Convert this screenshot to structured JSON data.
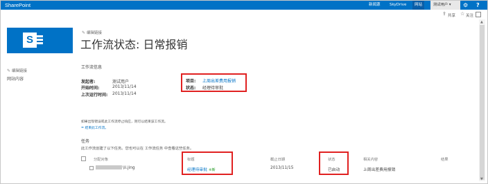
{
  "suite": {
    "brand": "SharePoint",
    "links": [
      "新闻源",
      "SkyDrive",
      "网站"
    ],
    "user": "测试用户 ▾",
    "settings_icon": "gear-icon",
    "help_icon": "question-icon"
  },
  "actions": {
    "share": "共享",
    "follow": "关注"
  },
  "edit_links": {
    "top": "编辑链接",
    "left": "编辑链接"
  },
  "page": {
    "title": "工作流状态: 日常报销"
  },
  "left_nav": {
    "site_contents": "网站内容"
  },
  "workflow_info": {
    "header": "工作流信息",
    "initiator_label": "发起者:",
    "initiator": "测试用户",
    "started_label": "开始时间:",
    "started": "2013/11/14",
    "last_run_label": "上次运行时间:",
    "last_run": "2013/11/14",
    "item_label": "项目:",
    "item": "上周出差费用报销",
    "status_label": "状态:",
    "status": "经理待审批"
  },
  "notes": {
    "line1": "如果出现错误或此工作流停止响应，则可以结束该工作流。",
    "line2": "= 结束此工作流。"
  },
  "tasks": {
    "header": "任务",
    "intro": "此工作流创建了以下任务。您也可以在 工作流任务 中查看这些任务。",
    "columns": [
      "分配对象",
      "标题",
      "截止日期",
      "状态",
      "相关内容",
      "结果"
    ],
    "rows": [
      {
        "assigned_suffix": "\\li.jing",
        "title": "经理待审批",
        "new_badge": "※新",
        "due": "2013/11/15",
        "status": "已启动",
        "related": "上周出差费用报销",
        "outcome": ""
      }
    ]
  },
  "colors": {
    "accent": "#0072c6",
    "highlight": "#e02020"
  }
}
